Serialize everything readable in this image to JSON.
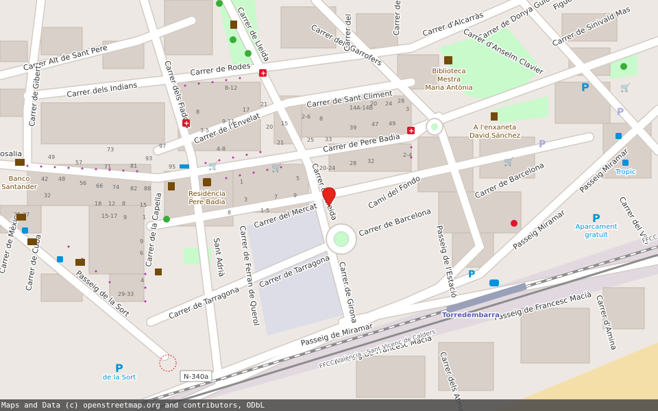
{
  "streets": {
    "alt_sant_pere": "Carrer Alt de Sant Pere",
    "gibert": "Carrer de Gibert",
    "indians": "Carrer dels Indians",
    "rodes": "Carrer de Rodes",
    "lleida_top": "Carrer de Lleida",
    "lleida_mid": "Carrer de Lleida",
    "garrofers": "Carrer dels Garrofers",
    "carrer_del": "Carrer del",
    "carrer_de_la_v": "Carrer de la V",
    "alcarras": "Carrer d'Alcarràs",
    "donya_guiomar": "Carrer de Donya Guiomar",
    "anselm_clavier": "Carrer d'Anselm Clavier",
    "sinivald_mas": "Carrer de Sinivald Mas",
    "figuera": "Figuera",
    "fiadors": "Carrer dels Fiadors",
    "envelat": "Carrer de l'Envelat",
    "sant_climent": "Carrer de Sant Climent",
    "pere_badia": "Carrer de Pere Badia",
    "rosalia": "osalia",
    "cami_fondo": "Camí del Fondo",
    "mercat": "Carrer del Mercat",
    "barcelona_1": "Carrer de Barcelona",
    "barcelona_2": "Carrer de Barcelona",
    "passeig_miramar_1": "Passeig Miramar",
    "passeig_miramar_2": "Passeig Miramar",
    "passeig_de_miramar": "Passeig de Miramar",
    "capella": "Carrer de la Capella",
    "sant_adria": "Sant Adrià",
    "ferran_querol": "Carrer de Ferran de Querol",
    "tarragona_1": "Carrer de Tarragona",
    "tarragona_2": "Carrer de Tarragona",
    "girona": "Carrer de Girona",
    "estacio": "Passeig de l'Estació",
    "vilo": "Carrer del Vilo",
    "mexic": "Carrer de Mèxic",
    "cuba": "Carrer de Cuba",
    "sort": "Passeig de la Sort",
    "francesc_macia_1": "Passeig de Francesc Macià",
    "francesc_macia_2": "Passeig de Francesc Macià",
    "amina": "Carrer d'Amina",
    "atmetller": "Carrer dels Atmet",
    "ffcc_1": "FFCC València - Sant Vicenç de Calders",
    "ffcc_2": "FFCC",
    "n340a": "N-340a"
  },
  "pois": {
    "biblioteca_1": "Biblioteca",
    "biblioteca_2": "Mestra",
    "biblioteca_3": "Maria Antònia",
    "enxaneta_1": "A l'enxaneta",
    "enxaneta_2": "David Sánchez",
    "residencia_1": "Residència",
    "residencia_2": "Pere Badia",
    "banco_1": "Banco",
    "banco_2": "Santander",
    "tropic": "Tropic",
    "aparcament_1": "Aparcament",
    "aparcament_2": "gratuït",
    "sort_parking": "de la Sort",
    "station": "Torredembarra"
  },
  "house_numbers": [
    "8-12",
    "8",
    "3-5",
    "4-8",
    "9-11",
    "17",
    "21",
    "20",
    "15",
    "21",
    "2-6",
    "8",
    "14A-14B",
    "20",
    "24",
    "28",
    "3",
    "39",
    "25",
    "33",
    "47",
    "49",
    "2-4",
    "20-24",
    "28",
    "32",
    "1",
    "3",
    "7",
    "9",
    "1-5",
    "5",
    "8",
    "73",
    "97",
    "95",
    "49",
    "57",
    "71",
    "81",
    "93",
    "42",
    "48",
    "56",
    "66",
    "74",
    "82",
    "88",
    "32",
    "18",
    "12",
    "8",
    "15",
    "25-27",
    "15-17",
    "9",
    "1",
    "29-33",
    "9",
    "6",
    "4"
  ],
  "attribution": "Maps and Data (c) openstreetmap.org and contributors, ODbL",
  "colors": {
    "background": "#ede8e3",
    "road": "#ffffff",
    "road_casing": "#d3cbc4",
    "building": "#d9d0c9",
    "park": "#c8facc",
    "marker": "#e8231b",
    "railway": "#8c8c8c",
    "poi_blue": "#0092da",
    "poi_brown": "#734a08",
    "hospital": "#e0152b",
    "sand": "#f5dfa8"
  },
  "marker": {
    "icon": "map-pin-icon"
  }
}
